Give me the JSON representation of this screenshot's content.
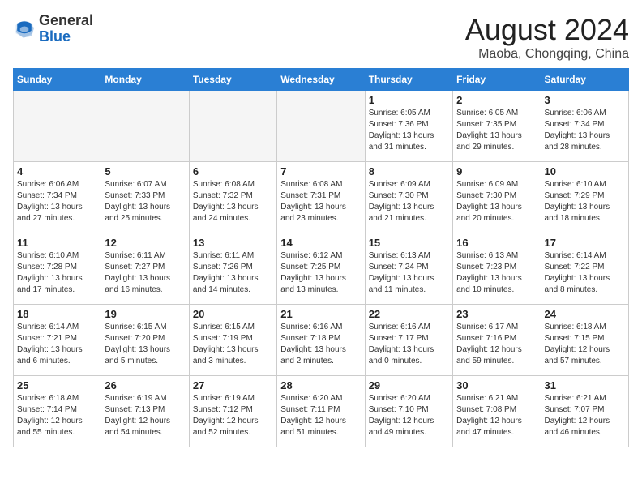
{
  "header": {
    "logo_general": "General",
    "logo_blue": "Blue",
    "month_year": "August 2024",
    "location": "Maoba, Chongqing, China"
  },
  "weekdays": [
    "Sunday",
    "Monday",
    "Tuesday",
    "Wednesday",
    "Thursday",
    "Friday",
    "Saturday"
  ],
  "weeks": [
    [
      {
        "day": "",
        "info": ""
      },
      {
        "day": "",
        "info": ""
      },
      {
        "day": "",
        "info": ""
      },
      {
        "day": "",
        "info": ""
      },
      {
        "day": "1",
        "info": "Sunrise: 6:05 AM\nSunset: 7:36 PM\nDaylight: 13 hours\nand 31 minutes."
      },
      {
        "day": "2",
        "info": "Sunrise: 6:05 AM\nSunset: 7:35 PM\nDaylight: 13 hours\nand 29 minutes."
      },
      {
        "day": "3",
        "info": "Sunrise: 6:06 AM\nSunset: 7:34 PM\nDaylight: 13 hours\nand 28 minutes."
      }
    ],
    [
      {
        "day": "4",
        "info": "Sunrise: 6:06 AM\nSunset: 7:34 PM\nDaylight: 13 hours\nand 27 minutes."
      },
      {
        "day": "5",
        "info": "Sunrise: 6:07 AM\nSunset: 7:33 PM\nDaylight: 13 hours\nand 25 minutes."
      },
      {
        "day": "6",
        "info": "Sunrise: 6:08 AM\nSunset: 7:32 PM\nDaylight: 13 hours\nand 24 minutes."
      },
      {
        "day": "7",
        "info": "Sunrise: 6:08 AM\nSunset: 7:31 PM\nDaylight: 13 hours\nand 23 minutes."
      },
      {
        "day": "8",
        "info": "Sunrise: 6:09 AM\nSunset: 7:30 PM\nDaylight: 13 hours\nand 21 minutes."
      },
      {
        "day": "9",
        "info": "Sunrise: 6:09 AM\nSunset: 7:30 PM\nDaylight: 13 hours\nand 20 minutes."
      },
      {
        "day": "10",
        "info": "Sunrise: 6:10 AM\nSunset: 7:29 PM\nDaylight: 13 hours\nand 18 minutes."
      }
    ],
    [
      {
        "day": "11",
        "info": "Sunrise: 6:10 AM\nSunset: 7:28 PM\nDaylight: 13 hours\nand 17 minutes."
      },
      {
        "day": "12",
        "info": "Sunrise: 6:11 AM\nSunset: 7:27 PM\nDaylight: 13 hours\nand 16 minutes."
      },
      {
        "day": "13",
        "info": "Sunrise: 6:11 AM\nSunset: 7:26 PM\nDaylight: 13 hours\nand 14 minutes."
      },
      {
        "day": "14",
        "info": "Sunrise: 6:12 AM\nSunset: 7:25 PM\nDaylight: 13 hours\nand 13 minutes."
      },
      {
        "day": "15",
        "info": "Sunrise: 6:13 AM\nSunset: 7:24 PM\nDaylight: 13 hours\nand 11 minutes."
      },
      {
        "day": "16",
        "info": "Sunrise: 6:13 AM\nSunset: 7:23 PM\nDaylight: 13 hours\nand 10 minutes."
      },
      {
        "day": "17",
        "info": "Sunrise: 6:14 AM\nSunset: 7:22 PM\nDaylight: 13 hours\nand 8 minutes."
      }
    ],
    [
      {
        "day": "18",
        "info": "Sunrise: 6:14 AM\nSunset: 7:21 PM\nDaylight: 13 hours\nand 6 minutes."
      },
      {
        "day": "19",
        "info": "Sunrise: 6:15 AM\nSunset: 7:20 PM\nDaylight: 13 hours\nand 5 minutes."
      },
      {
        "day": "20",
        "info": "Sunrise: 6:15 AM\nSunset: 7:19 PM\nDaylight: 13 hours\nand 3 minutes."
      },
      {
        "day": "21",
        "info": "Sunrise: 6:16 AM\nSunset: 7:18 PM\nDaylight: 13 hours\nand 2 minutes."
      },
      {
        "day": "22",
        "info": "Sunrise: 6:16 AM\nSunset: 7:17 PM\nDaylight: 13 hours\nand 0 minutes."
      },
      {
        "day": "23",
        "info": "Sunrise: 6:17 AM\nSunset: 7:16 PM\nDaylight: 12 hours\nand 59 minutes."
      },
      {
        "day": "24",
        "info": "Sunrise: 6:18 AM\nSunset: 7:15 PM\nDaylight: 12 hours\nand 57 minutes."
      }
    ],
    [
      {
        "day": "25",
        "info": "Sunrise: 6:18 AM\nSunset: 7:14 PM\nDaylight: 12 hours\nand 55 minutes."
      },
      {
        "day": "26",
        "info": "Sunrise: 6:19 AM\nSunset: 7:13 PM\nDaylight: 12 hours\nand 54 minutes."
      },
      {
        "day": "27",
        "info": "Sunrise: 6:19 AM\nSunset: 7:12 PM\nDaylight: 12 hours\nand 52 minutes."
      },
      {
        "day": "28",
        "info": "Sunrise: 6:20 AM\nSunset: 7:11 PM\nDaylight: 12 hours\nand 51 minutes."
      },
      {
        "day": "29",
        "info": "Sunrise: 6:20 AM\nSunset: 7:10 PM\nDaylight: 12 hours\nand 49 minutes."
      },
      {
        "day": "30",
        "info": "Sunrise: 6:21 AM\nSunset: 7:08 PM\nDaylight: 12 hours\nand 47 minutes."
      },
      {
        "day": "31",
        "info": "Sunrise: 6:21 AM\nSunset: 7:07 PM\nDaylight: 12 hours\nand 46 minutes."
      }
    ]
  ]
}
